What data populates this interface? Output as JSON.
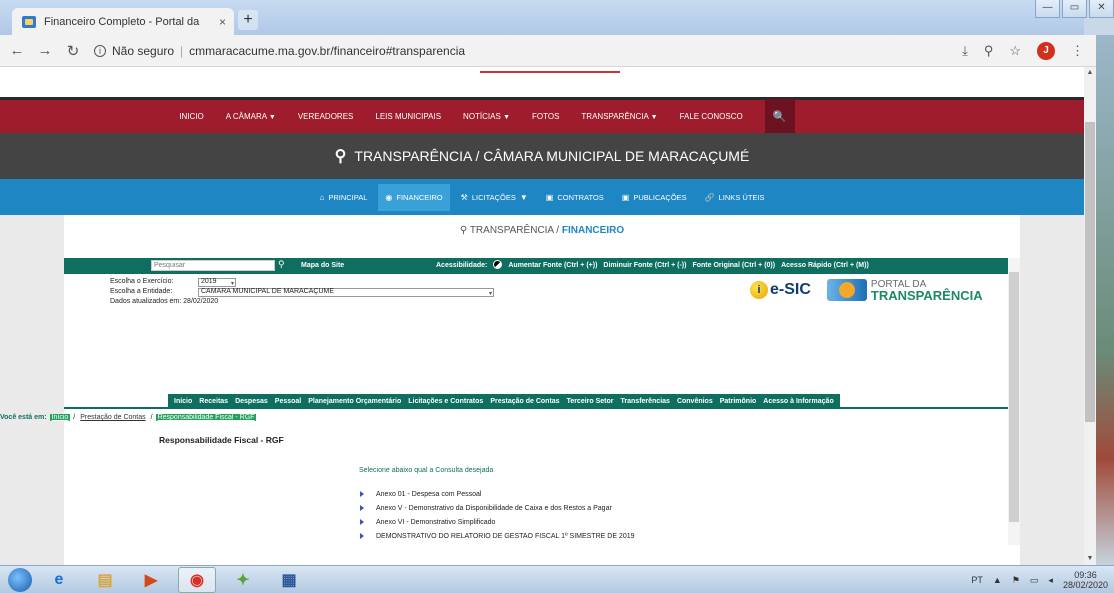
{
  "browser": {
    "tab_title": "Financeiro Completo - Portal da",
    "tab_close": "×",
    "new_tab": "+",
    "not_secure": "Não seguro",
    "url": "cmmaracacume.ma.gov.br/financeiro#transparencia",
    "avatar_letter": "J"
  },
  "main_nav": {
    "items": [
      "INICIO",
      "A CÂMARA",
      "VEREADORES",
      "LEIS MUNICIPAIS",
      "NOTÍCIAS",
      "FOTOS",
      "TRANSPARÊNCIA",
      "FALE CONOSCO"
    ]
  },
  "title_band": "TRANSPARÊNCIA / CÂMARA MUNICIPAL DE MARACAÇUMÉ",
  "sub_nav": {
    "items": [
      "PRINCIPAL",
      "FINANCEIRO",
      "LICITAÇÕES",
      "CONTRATOS",
      "PUBLICAÇÕES",
      "LINKS ÚTEIS"
    ]
  },
  "crumb_head": {
    "prefix": "TRANSPARÊNCIA / ",
    "current": "FINANCEIRO"
  },
  "toolbar": {
    "search_placeholder": "Pesquisar",
    "site_map": "Mapa do Site",
    "accessibility": "Acessibilidade:",
    "increase_font": "Aumentar Fonte (Ctrl + (+))",
    "decrease_font": "Diminuir Fonte (Ctrl + (-))",
    "original_font": "Fonte Original (Ctrl + (0))",
    "quick_access": "Acesso Rápido (Ctrl + (M))"
  },
  "filters": {
    "year_label": "Escolha o Exercício:",
    "year_value": "2019",
    "entity_label": "Escolha a Entidade:",
    "entity_value": "CAMARA MUNICIPAL DE MARACAÇUME",
    "updated": "Dados atualizados em: 28/02/2020"
  },
  "logos": {
    "esic": "e-SIC",
    "esic_i": "i",
    "portal_top": "PORTAL DA",
    "portal_bottom": "TRANSPARÊNCIA"
  },
  "menu2": [
    "Início",
    "Receitas",
    "Despesas",
    "Pessoal",
    "Planejamento Orçamentário",
    "Licitações e Contratos",
    "Prestação de Contas",
    "Terceiro Setor",
    "Transferências",
    "Convênios",
    "Patrimônio",
    "Acesso à Informação"
  ],
  "you_are_here": {
    "label": "Você está em:",
    "crumbs": [
      "Início",
      "Prestação de Contas",
      "Responsabilidade Fiscal - RGF"
    ],
    "sep": "/"
  },
  "page_title": "Responsabilidade Fiscal - RGF",
  "choose_text": "Selecione abaixo qual a Consulta desejada",
  "links": [
    "Anexo 01 - Despesa com Pessoal",
    "Anexo V - Demonstrativo da Disponibilidade de Caixa e dos Restos a Pagar",
    "Anexo VI - Demonstrativo Simplificado",
    "DEMONSTRATIVO DO RELATORIO DE GESTAO FISCAL 1º SIMESTRE DE 2019"
  ],
  "taskbar": {
    "lang": "PT",
    "time": "09:36",
    "date": "28/02/2020"
  }
}
